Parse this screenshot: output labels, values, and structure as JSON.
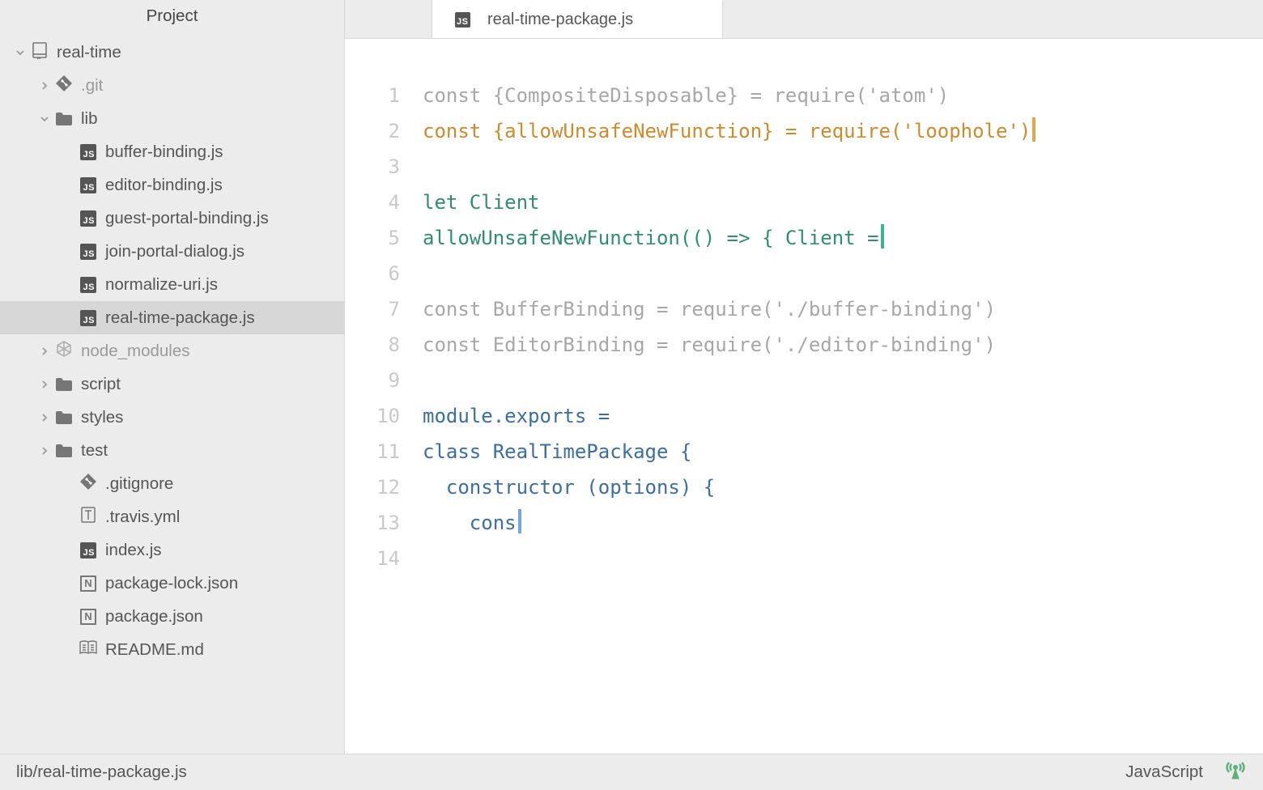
{
  "sidebar": {
    "title": "Project",
    "tree": [
      {
        "depth": 0,
        "chev": "down",
        "icon": "repo",
        "label": "real-time"
      },
      {
        "depth": 1,
        "chev": "right",
        "icon": "git",
        "label": ".git",
        "muted": true
      },
      {
        "depth": 1,
        "chev": "down",
        "icon": "folder",
        "label": "lib"
      },
      {
        "depth": 2,
        "chev": "",
        "icon": "js",
        "label": "buffer-binding.js"
      },
      {
        "depth": 2,
        "chev": "",
        "icon": "js",
        "label": "editor-binding.js"
      },
      {
        "depth": 2,
        "chev": "",
        "icon": "js",
        "label": "guest-portal-binding.js"
      },
      {
        "depth": 2,
        "chev": "",
        "icon": "js",
        "label": "join-portal-dialog.js"
      },
      {
        "depth": 2,
        "chev": "",
        "icon": "js",
        "label": "normalize-uri.js"
      },
      {
        "depth": 2,
        "chev": "",
        "icon": "js",
        "label": "real-time-package.js",
        "selected": true
      },
      {
        "depth": 1,
        "chev": "right",
        "icon": "node",
        "label": "node_modules",
        "muted": true
      },
      {
        "depth": 1,
        "chev": "right",
        "icon": "folder",
        "label": "script"
      },
      {
        "depth": 1,
        "chev": "right",
        "icon": "folder",
        "label": "styles"
      },
      {
        "depth": 1,
        "chev": "right",
        "icon": "folder",
        "label": "test"
      },
      {
        "depth": 2,
        "chev": "",
        "icon": "git",
        "label": ".gitignore"
      },
      {
        "depth": 2,
        "chev": "",
        "icon": "txt",
        "label": ".travis.yml"
      },
      {
        "depth": 2,
        "chev": "",
        "icon": "js",
        "label": "index.js"
      },
      {
        "depth": 2,
        "chev": "",
        "icon": "n",
        "label": "package-lock.json"
      },
      {
        "depth": 2,
        "chev": "",
        "icon": "n",
        "label": "package.json"
      },
      {
        "depth": 2,
        "chev": "",
        "icon": "book",
        "label": "README.md"
      }
    ]
  },
  "tab": {
    "filename": "real-time-package.js"
  },
  "code": {
    "lines": [
      {
        "n": "1",
        "segs": [
          {
            "t": "const {CompositeDisposable} = require('atom')",
            "c": "c-gray"
          }
        ]
      },
      {
        "n": "2",
        "segs": [
          {
            "t": "const {allowUnsafeNewFunction} = require('loophole')",
            "c": "c-orange"
          }
        ],
        "cursor": "orange"
      },
      {
        "n": "3",
        "segs": []
      },
      {
        "n": "4",
        "segs": [
          {
            "t": "let Client",
            "c": "c-green"
          }
        ]
      },
      {
        "n": "5",
        "segs": [
          {
            "t": "allowUnsafeNewFunction(() => { Client =",
            "c": "c-green"
          }
        ],
        "cursor": "green"
      },
      {
        "n": "6",
        "segs": []
      },
      {
        "n": "7",
        "segs": [
          {
            "t": "const BufferBinding = require('./buffer-binding')",
            "c": "c-gray"
          }
        ]
      },
      {
        "n": "8",
        "segs": [
          {
            "t": "const EditorBinding = require('./editor-binding')",
            "c": "c-gray"
          }
        ]
      },
      {
        "n": "9",
        "segs": []
      },
      {
        "n": "10",
        "segs": [
          {
            "t": "module.exports =",
            "c": "c-blue"
          }
        ]
      },
      {
        "n": "11",
        "segs": [
          {
            "t": "class RealTimePackage {",
            "c": "c-blue"
          }
        ]
      },
      {
        "n": "12",
        "segs": [
          {
            "t": "  constructor (options) {",
            "c": "c-blue"
          }
        ]
      },
      {
        "n": "13",
        "segs": [
          {
            "t": "    cons",
            "c": "c-blue"
          }
        ],
        "cursor": "blue"
      },
      {
        "n": "14",
        "segs": []
      }
    ]
  },
  "status": {
    "path": "lib/real-time-package.js",
    "lang": "JavaScript"
  }
}
